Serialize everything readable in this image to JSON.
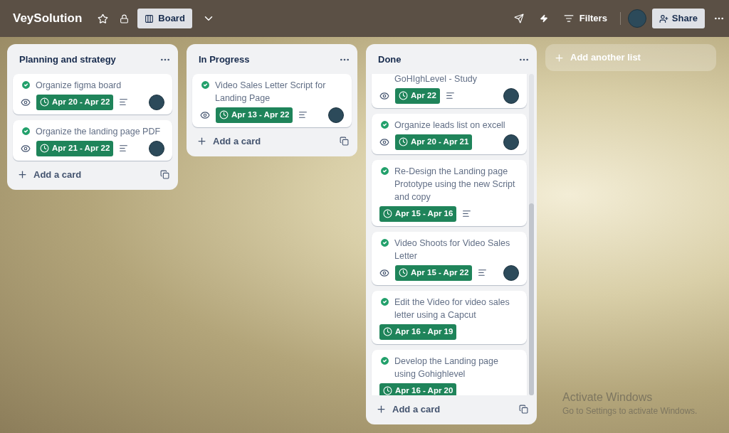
{
  "header": {
    "board_name": "VeySolution",
    "starred": false,
    "view_button": "Board",
    "filters_label": "Filters",
    "share_label": "Share"
  },
  "lists": [
    {
      "title": "Planning and strategy",
      "scrolled": false,
      "add_card": "Add a card",
      "cards": [
        {
          "title": "Organize figma board",
          "complete": true,
          "watching": true,
          "date": "Apr 20 - Apr 22",
          "description": true,
          "member": true
        },
        {
          "title": "Organize the landing page PDF",
          "complete": true,
          "watching": true,
          "date": "Apr 21 - Apr 22",
          "description": true,
          "member": true
        }
      ]
    },
    {
      "title": "In Progress",
      "scrolled": false,
      "add_card": "Add a card",
      "cards": [
        {
          "title": "Video Sales Letter Script for Landing Page",
          "complete": true,
          "watching": true,
          "date": "Apr 13 - Apr 22",
          "description": true,
          "member": true
        }
      ]
    },
    {
      "title": "Done",
      "scrolled": true,
      "add_card": "Add a card",
      "cards": [
        {
          "title": "GoHIghLevel - Study",
          "watching": true,
          "date": "Apr 22",
          "description": true,
          "member": true
        },
        {
          "title": "Organize leads list on excell",
          "complete": true,
          "watching": true,
          "date": "Apr 20 - Apr 21",
          "description": false,
          "member": true
        },
        {
          "title": "Re-Design the Landing page Prototype using the new Script and copy",
          "complete": true,
          "watching": false,
          "date": "Apr 15 - Apr 16",
          "description": true,
          "member": false
        },
        {
          "title": "Video Shoots for Video Sales Letter",
          "complete": true,
          "watching": true,
          "date": "Apr 15 - Apr 22",
          "description": true,
          "member": true
        },
        {
          "title": "Edit the Video for video sales letter using a Capcut",
          "complete": true,
          "watching": false,
          "date": "Apr 16 - Apr 19",
          "description": false,
          "member": false
        },
        {
          "title": "Develop the Landing page using Gohighlevel",
          "complete": true,
          "watching": false,
          "date": "Apr 16 - Apr 20",
          "description": false,
          "member": false
        }
      ]
    }
  ],
  "add_list": "Add another list",
  "os_notice": {
    "title": "Activate Windows",
    "text": "Go to Settings to activate Windows."
  }
}
